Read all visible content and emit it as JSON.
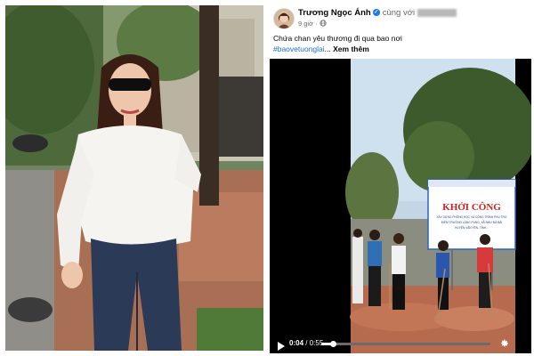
{
  "post": {
    "author": "Trương Ngọc Ánh",
    "with_label": "cùng với",
    "time": "9 giờ",
    "caption": "Chứa chan yêu thương đi qua bao nơi",
    "hashtag": "#baovetuonglai",
    "ellipsis": "...",
    "see_more": "Xem thêm"
  },
  "video": {
    "current_time": "0:04",
    "separator": "/",
    "duration": "0:55",
    "progress": 0.07,
    "banner": {
      "title": "KHỞI CÔNG",
      "line1": "XÂY DỰNG PHÒNG HỌC VÀ CÔNG TRÌNH PHỤ TRỢ",
      "line2": "ĐIỂM TRƯỜNG LÀNG PUNG, XÃ NHƯ ĐÀ BÁI",
      "line3": "HUYỆN VĂN YÊN, TỈNH..."
    }
  },
  "icons": {
    "play": "play-icon",
    "settings": "gear-icon",
    "verified": "verified-badge-icon"
  },
  "colors": {
    "link": "#216fdb",
    "verified": "#1877f2",
    "banner_title": "#d11f1f"
  }
}
